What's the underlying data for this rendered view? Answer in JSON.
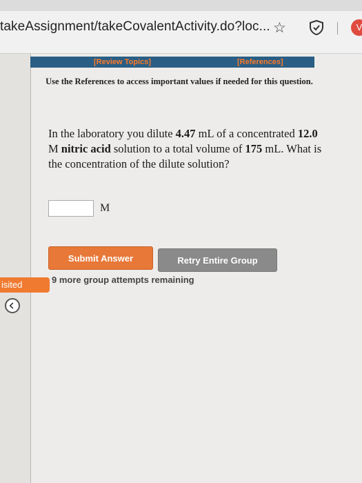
{
  "browser": {
    "url": "takeAssignment/takeCovalentActivity.do?loc...",
    "ext_label": "V"
  },
  "nav": {
    "review_topics": "[Review Topics]",
    "references": "[References]"
  },
  "instructions": "Use the References to access important values if needed for this question.",
  "question": {
    "part1": "In the laboratory you dilute ",
    "volume1": "4.47",
    "part2": " mL of a concentrated ",
    "molarity": "12.0",
    "part3": " M ",
    "substance": "nitric acid",
    "part4": " solution to a total volume of ",
    "volume2": "175",
    "part5": " mL. What is the concentration of the dilute solution?"
  },
  "answer": {
    "value": "",
    "unit": "M"
  },
  "buttons": {
    "submit": "Submit Answer",
    "retry": "Retry Entire Group"
  },
  "attempts": "9 more group attempts remaining",
  "sidebar": {
    "visited": "isited"
  },
  "colors": {
    "nav_bar": "#2a5e84",
    "nav_link": "#ff7a28",
    "submit": "#e87838",
    "retry": "#8a8a8a"
  }
}
